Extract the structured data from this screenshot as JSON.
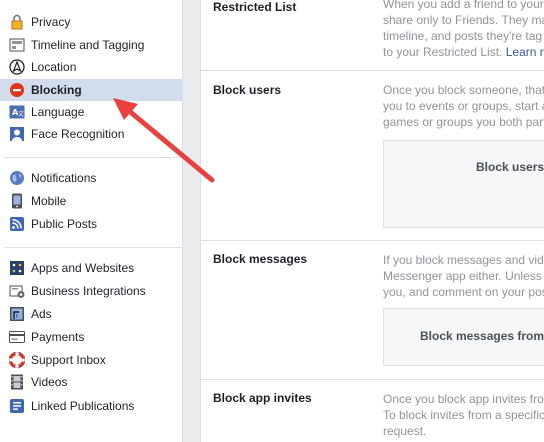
{
  "sidebar": {
    "groups": [
      [
        {
          "label": "Privacy",
          "icon": "lock-icon"
        },
        {
          "label": "Timeline and Tagging",
          "icon": "timeline-icon"
        },
        {
          "label": "Location",
          "icon": "location-icon"
        },
        {
          "label": "Blocking",
          "icon": "blocking-icon",
          "active": true
        },
        {
          "label": "Language",
          "icon": "language-icon"
        },
        {
          "label": "Face Recognition",
          "icon": "face-recognition-icon"
        }
      ],
      [
        {
          "label": "Notifications",
          "icon": "globe-icon"
        },
        {
          "label": "Mobile",
          "icon": "mobile-icon"
        },
        {
          "label": "Public Posts",
          "icon": "rss-icon"
        }
      ],
      [
        {
          "label": "Apps and Websites",
          "icon": "apps-icon"
        },
        {
          "label": "Business Integrations",
          "icon": "business-gear-icon"
        },
        {
          "label": "Ads",
          "icon": "ads-icon"
        },
        {
          "label": "Payments",
          "icon": "payments-card-icon"
        },
        {
          "label": "Support Inbox",
          "icon": "lifebuoy-icon"
        },
        {
          "label": "Videos",
          "icon": "film-icon"
        },
        {
          "label": "Linked Publications",
          "icon": "publications-icon"
        }
      ]
    ]
  },
  "main": {
    "restricted": {
      "title": "Restricted List",
      "desc": [
        "When you add a friend to your",
        "share only to Friends. They ma",
        "timeline, and posts they're tag",
        "to your Restricted List. "
      ],
      "link": "Learn m"
    },
    "block_users": {
      "title": "Block users",
      "desc": [
        "Once you block someone, that",
        "you to events or groups, start a",
        "games or groups you both part"
      ],
      "box_label": "Block users"
    },
    "block_messages": {
      "title": "Block messages",
      "desc": [
        "If you block messages and vid",
        "Messenger app either. Unless",
        "you, and comment on your pos"
      ],
      "box_label": "Block messages from"
    },
    "block_app_invites": {
      "title": "Block app invites",
      "desc": [
        "Once you block app invites fro",
        "To block invites from a specific",
        "request."
      ]
    }
  },
  "colors": {
    "active_bg": "#d3dcec",
    "arrow": "#e8413f",
    "link": "#365899",
    "blocking_red": "#e0341f"
  }
}
